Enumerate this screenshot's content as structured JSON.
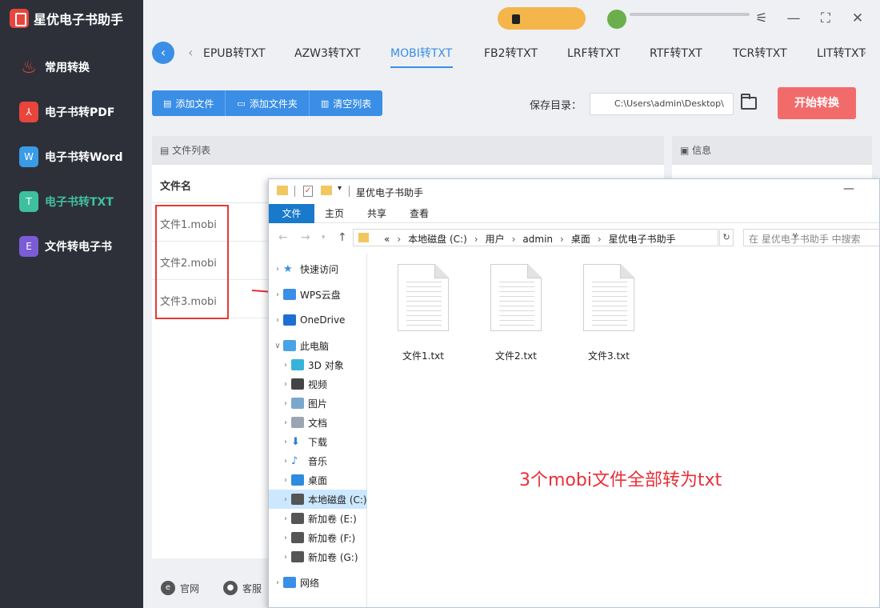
{
  "app": {
    "title": "星优电子书助手"
  },
  "sidebar": {
    "items": [
      {
        "label": "常用转换",
        "icon": "flame-icon",
        "color": "#e8453c",
        "glyph": ""
      },
      {
        "label": "电子书转PDF",
        "icon": "pdf-icon",
        "color": "#e8453c",
        "glyph": "⅄"
      },
      {
        "label": "电子书转Word",
        "icon": "word-icon",
        "color": "#3a9be6",
        "glyph": "W"
      },
      {
        "label": "电子书转TXT",
        "icon": "txt-icon",
        "color": "#3ec0a0",
        "glyph": "T"
      },
      {
        "label": "文件转电子书",
        "icon": "ebook-icon",
        "color": "#7a5cd6",
        "glyph": "E"
      }
    ],
    "active": 3
  },
  "tabs": [
    "EPUB转TXT",
    "AZW3转TXT",
    "MOBI转TXT",
    "FB2转TXT",
    "LRF转TXT",
    "RTF转TXT",
    "TCR转TXT",
    "LIT转TXT"
  ],
  "active_tab": 2,
  "toolbar": {
    "add_file": "添加文件",
    "add_folder": "添加文件夹",
    "clear_list": "清空列表",
    "save_label": "保存目录：",
    "save_path": "C:\\Users\\admin\\Desktop\\",
    "start": "开始转换"
  },
  "file_panel": {
    "title": "文件列表",
    "column": "文件名",
    "files": [
      "文件1.mobi",
      "文件2.mobi",
      "文件3.mobi"
    ]
  },
  "info_panel": {
    "title": "信息"
  },
  "footer": {
    "website": "官网",
    "support": "客服"
  },
  "explorer": {
    "title": "星优电子书助手",
    "ribbon": [
      "文件",
      "主页",
      "共享",
      "查看"
    ],
    "address": [
      "«",
      "本地磁盘 (C:)",
      "用户",
      "admin",
      "桌面",
      "星优电子书助手"
    ],
    "search_placeholder": "在 星优电子书助手 中搜索",
    "nav": [
      {
        "label": "快速访问",
        "icon": "star-icon",
        "color": "#3a8ee6"
      },
      {
        "label": "WPS云盘",
        "icon": "cloud-icon",
        "color": "#3a8ee6"
      },
      {
        "label": "OneDrive",
        "icon": "onedrive-icon",
        "color": "#1d6fd1"
      },
      {
        "label": "此电脑",
        "icon": "computer-icon",
        "color": "#4aa3e6"
      },
      {
        "label": "3D 对象",
        "icon": "cube-icon",
        "color": "#37b3d9"
      },
      {
        "label": "视频",
        "icon": "film-icon",
        "color": "#444"
      },
      {
        "label": "图片",
        "icon": "picture-icon",
        "color": "#7aa7cc"
      },
      {
        "label": "文档",
        "icon": "document-icon",
        "color": "#9aa5b1"
      },
      {
        "label": "下载",
        "icon": "download-icon",
        "color": "#2f7fd8"
      },
      {
        "label": "音乐",
        "icon": "music-icon",
        "color": "#2f7fd8"
      },
      {
        "label": "桌面",
        "icon": "desktop-icon",
        "color": "#2f8be0"
      },
      {
        "label": "本地磁盘 (C:)",
        "icon": "drive-c-icon",
        "color": "#555"
      },
      {
        "label": "新加卷 (E:)",
        "icon": "drive-e-icon",
        "color": "#555"
      },
      {
        "label": "新加卷 (F:)",
        "icon": "drive-f-icon",
        "color": "#555"
      },
      {
        "label": "新加卷 (G:)",
        "icon": "drive-g-icon",
        "color": "#555"
      },
      {
        "label": "网络",
        "icon": "network-icon",
        "color": "#3a8ee6"
      }
    ],
    "selected_nav": 11,
    "files": [
      "文件1.txt",
      "文件2.txt",
      "文件3.txt"
    ],
    "annotation": "3个mobi文件全部转为txt"
  },
  "colors": {
    "accent": "#3a8ee6",
    "start": "#f26b6b",
    "annotation": "#e8303a"
  }
}
